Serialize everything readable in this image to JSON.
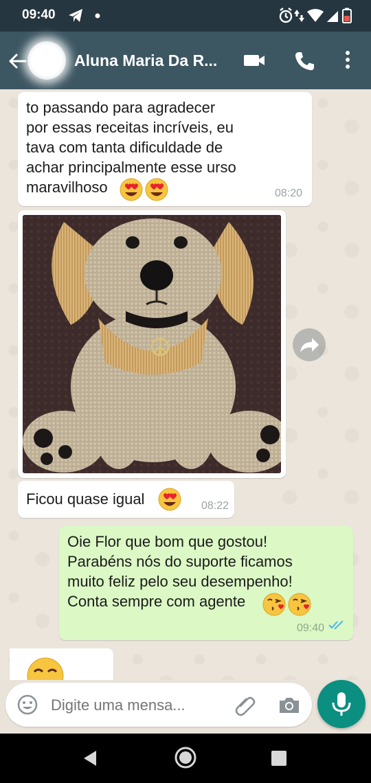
{
  "status_bar": {
    "time": "09:40",
    "icons": [
      "telegram-icon",
      "dot-icon",
      "alarm-icon",
      "data-arrows-icon",
      "wifi-icon",
      "signal-icon",
      "battery-icon"
    ]
  },
  "header": {
    "contact_name": "Aluna Maria Da R...",
    "icons": [
      "back-arrow-icon",
      "video-call-icon",
      "phone-icon",
      "more-vert-icon"
    ]
  },
  "messages": [
    {
      "direction": "incoming",
      "type": "text",
      "text": "to passando para agradecer\npor essas receitas incríveis, eu\ntava com tanta dificuldade de\nachar principalmente esse urso\nmaravilhoso",
      "emojis": [
        "heart-eyes-emoji",
        "heart-eyes-emoji"
      ],
      "time": "08:20"
    },
    {
      "direction": "incoming",
      "type": "image",
      "image_subject": "crocheted amigurumi dog with peace-sign collar"
    },
    {
      "direction": "incoming",
      "type": "text",
      "text": "Ficou quase igual",
      "emojis": [
        "heart-eyes-emoji"
      ],
      "time": "08:22"
    },
    {
      "direction": "outgoing",
      "type": "text",
      "text": "Oie Flor que bom que gostou!\nParabéns nós do suporte ficamos\nmuito feliz pelo seu desempenho!\nConta sempre com agente",
      "emojis": [
        "kissing-heart-emoji",
        "kissing-heart-emoji"
      ],
      "time": "09:40",
      "status": "read"
    },
    {
      "direction": "incoming",
      "type": "emoji",
      "emojis": [
        "smiling-emoji"
      ]
    }
  ],
  "composer": {
    "placeholder": "Digite uma mensa..."
  },
  "colors": {
    "header": "#3c5662",
    "status_bar": "#253640",
    "outgoing_bubble": "#dbf8c5",
    "incoming_bubble": "#ffffff",
    "mic_button": "#0a8f80",
    "read_ticks": "#4fb6ec"
  }
}
